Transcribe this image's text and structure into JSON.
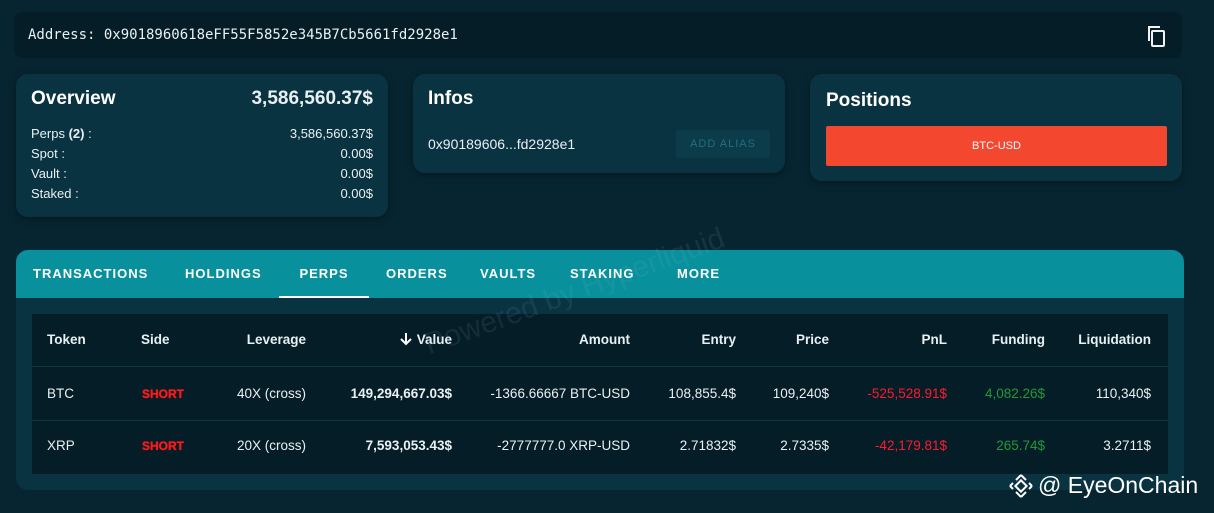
{
  "address": {
    "text": "Address: 0x9018960618eFF55F5852e345B7Cb5661fd2928e1",
    "copy_icon": "copy-icon"
  },
  "overview": {
    "title": "Overview",
    "total": "3,586,560.37$",
    "rows": [
      {
        "label": "Perps ",
        "count": "(2)",
        "suffix": " :",
        "value": "3,586,560.37$"
      },
      {
        "label": "Spot :",
        "value": "0.00$"
      },
      {
        "label": "Vault :",
        "value": "0.00$"
      },
      {
        "label": "Staked :",
        "value": "0.00$"
      }
    ]
  },
  "infos": {
    "title": "Infos",
    "short_address": "0x90189606...fd2928e1",
    "alias_button": "ADD ALIAS"
  },
  "positions": {
    "title": "Positions",
    "bar_label": "BTC-USD",
    "bar_color": "#f4472f"
  },
  "tabs": [
    "TRANSACTIONS",
    "HOLDINGS",
    "PERPS",
    "ORDERS",
    "VAULTS",
    "STAKING",
    "MORE"
  ],
  "active_tab": "PERPS",
  "table": {
    "headers": [
      "Token",
      "Side",
      "Leverage",
      "Value",
      "Amount",
      "Entry",
      "Price",
      "PnL",
      "Funding",
      "Liquidation"
    ],
    "sort_icon": "arrow-down-icon",
    "rows": [
      {
        "token": "BTC",
        "side": "SHORT",
        "leverage": "40X (cross)",
        "value": "149,294,667.03$",
        "amount": "-1366.66667 BTC-USD",
        "entry": "108,855.4$",
        "price": "109,240$",
        "pnl": "-525,528.91$",
        "funding": "4,082.26$",
        "liquidation": "110,340$"
      },
      {
        "token": "XRP",
        "side": "SHORT",
        "leverage": "20X (cross)",
        "value": "7,593,053.43$",
        "amount": "-2777777.0 XRP-USD",
        "entry": "2.71832$",
        "price": "2.7335$",
        "pnl": "-42,179.81$",
        "funding": "265.74$",
        "liquidation": "3.2711$"
      }
    ]
  },
  "watermark": "Powered by Hyperliquid",
  "brand": {
    "text": "@ EyeOnChain",
    "icon": "binance-logo-icon"
  },
  "colors": {
    "background": "#072530",
    "card": "#0a3342",
    "tabs": "#08919d",
    "short": "#ff1a1a",
    "negative": "#ff1a30",
    "positive": "#1f9a3a"
  }
}
